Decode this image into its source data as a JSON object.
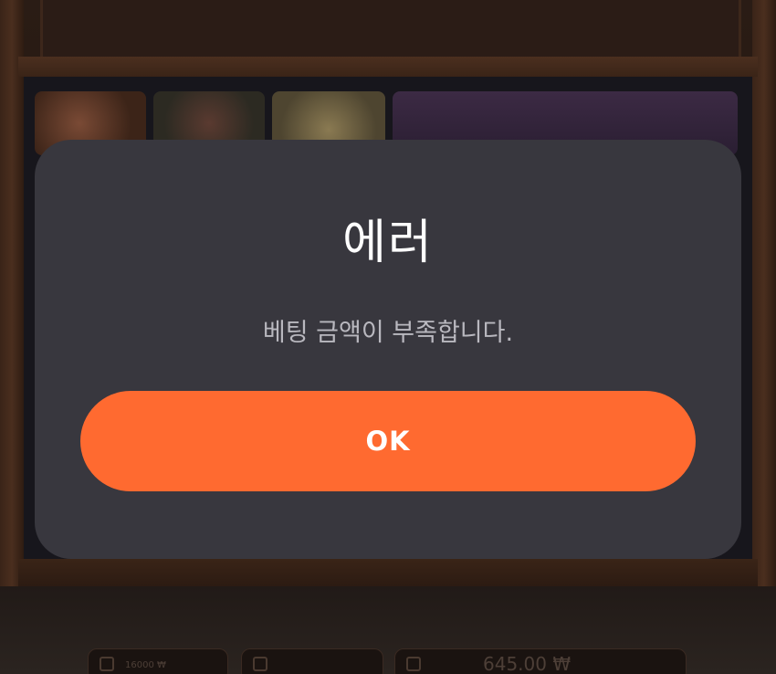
{
  "dialog": {
    "title": "에러",
    "message": "베팅 금액이 부족합니다.",
    "ok_label": "OK"
  },
  "hud": {
    "balance_icon": "coin-stack-icon",
    "bet_icon": "bet-icon",
    "win_icon": "wallet-icon",
    "balance_value": "16000 ₩",
    "win_value": "645.00 ₩"
  },
  "colors": {
    "dialog_bg": "#38373e",
    "accent": "#ff6a30",
    "title_text": "#ffffff",
    "message_text": "#b9b8bf"
  }
}
